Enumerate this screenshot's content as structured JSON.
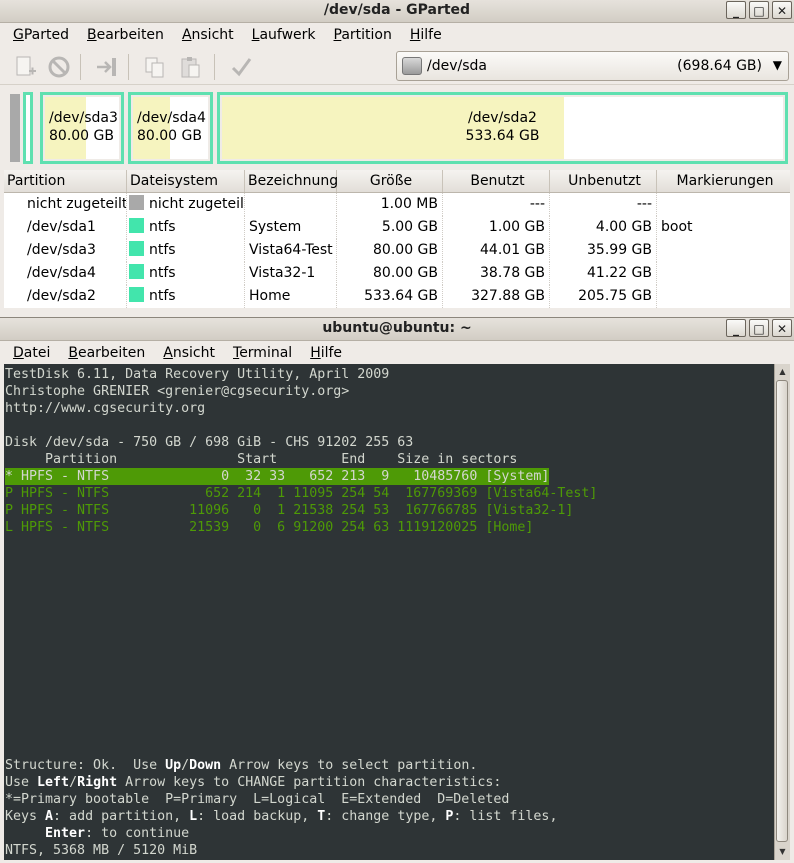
{
  "gparted": {
    "title": "/dev/sda - GParted",
    "menu": [
      {
        "label": "GParted",
        "u": "G",
        "rest": "Parted"
      },
      {
        "label": "Bearbeiten",
        "u": "B",
        "rest": "earbeiten"
      },
      {
        "label": "Ansicht",
        "u": "A",
        "rest": "nsicht"
      },
      {
        "label": "Laufwerk",
        "u": "L",
        "rest": "aufwerk"
      },
      {
        "label": "Partition",
        "u": "P",
        "rest": "artition"
      },
      {
        "label": "Hilfe",
        "u": "H",
        "rest": "ilfe"
      }
    ],
    "device": {
      "name": "/dev/sda",
      "size": "(698.64 GB)",
      "icon": "harddisk-icon"
    },
    "diskmap": [
      {
        "name": "/dev/sda3",
        "size": "80.00 GB",
        "used_fraction": 0.55
      },
      {
        "name": "/dev/sda4",
        "size": "80.00 GB",
        "used_fraction": 0.49
      },
      {
        "name": "/dev/sda2",
        "size": "533.64 GB",
        "used_fraction": 0.61
      }
    ],
    "columns": [
      "Partition",
      "Dateisystem",
      "Bezeichnung",
      "Größe",
      "Benutzt",
      "Unbenutzt",
      "Markierungen"
    ],
    "rows": [
      {
        "partition": "nicht zugeteilt",
        "fs": "nicht zugeteilt",
        "fs_color": "#a9a9a9",
        "label": "",
        "size": "1.00 MB",
        "used": "---",
        "unused": "---",
        "flags": ""
      },
      {
        "partition": "/dev/sda1",
        "fs": "ntfs",
        "fs_color": "#42e5ac",
        "label": "System",
        "size": "5.00 GB",
        "used": "1.00 GB",
        "unused": "4.00 GB",
        "flags": "boot"
      },
      {
        "partition": "/dev/sda3",
        "fs": "ntfs",
        "fs_color": "#42e5ac",
        "label": "Vista64-Test",
        "size": "80.00 GB",
        "used": "44.01 GB",
        "unused": "35.99 GB",
        "flags": ""
      },
      {
        "partition": "/dev/sda4",
        "fs": "ntfs",
        "fs_color": "#42e5ac",
        "label": "Vista32-1",
        "size": "80.00 GB",
        "used": "38.78 GB",
        "unused": "41.22 GB",
        "flags": ""
      },
      {
        "partition": "/dev/sda2",
        "fs": "ntfs",
        "fs_color": "#42e5ac",
        "label": "Home",
        "size": "533.64 GB",
        "used": "327.88 GB",
        "unused": "205.75 GB",
        "flags": ""
      }
    ]
  },
  "terminal": {
    "title": "ubuntu@ubuntu: ~",
    "menu": [
      {
        "label": "Datei",
        "u": "D",
        "rest": "atei"
      },
      {
        "label": "Bearbeiten",
        "u": "B",
        "rest": "earbeiten"
      },
      {
        "label": "Ansicht",
        "u": "A",
        "rest": "nsicht"
      },
      {
        "label": "Terminal",
        "u": "T",
        "rest": "erminal"
      },
      {
        "label": "Hilfe",
        "u": "H",
        "rest": "ilfe"
      }
    ],
    "header_lines": [
      "TestDisk 6.11, Data Recovery Utility, April 2009",
      "Christophe GRENIER <grenier@cgsecurity.org>",
      "http://www.cgsecurity.org",
      "",
      "Disk /dev/sda - 750 GB / 698 GiB - CHS 91202 255 63",
      "     Partition               Start        End    Size in sectors"
    ],
    "partition_lines": [
      "* HPFS - NTFS              0  32 33   652 213  9   10485760 [System]",
      "P HPFS - NTFS            652 214  1 11095 254 54  167769369 [Vista64-Test]",
      "P HPFS - NTFS          11096   0  1 21538 254 53  167766785 [Vista32-1]",
      "L HPFS - NTFS          21539   0  6 91200 254 63 1119120025 [Home]"
    ],
    "footer": {
      "l1a": "Structure: Ok.  Use ",
      "l1b": "Up",
      "l1c": "/",
      "l1d": "Down",
      "l1e": " Arrow keys to select partition.",
      "l2a": "Use ",
      "l2b": "Left",
      "l2c": "/",
      "l2d": "Right",
      "l2e": " Arrow keys to CHANGE partition characteristics:",
      "l3": "*=Primary bootable  P=Primary  L=Logical  E=Extended  D=Deleted",
      "l4a": "Keys ",
      "l4b": "A",
      "l4c": ": add partition, ",
      "l4d": "L",
      "l4e": ": load backup, ",
      "l4f": "T",
      "l4g": ": change type, ",
      "l4h": "P",
      "l4i": ": list files,",
      "l5a": "     ",
      "l5b": "Enter",
      "l5c": ": to continue",
      "l6": "NTFS, 5368 MB / 5120 MiB"
    }
  }
}
